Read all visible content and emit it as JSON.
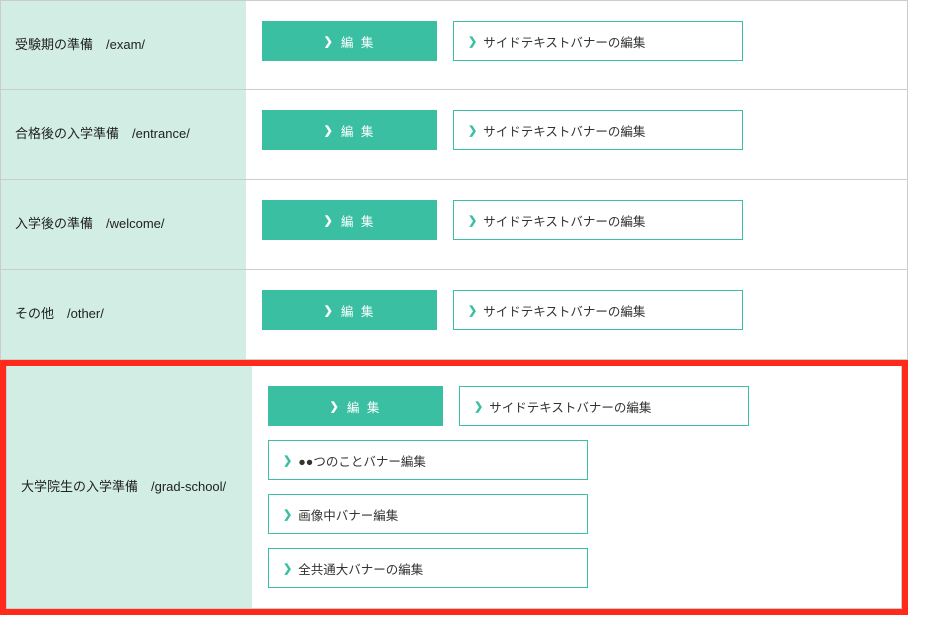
{
  "edit_label": "編 集",
  "side_banner_label": "サイドテキストバナーの編集",
  "rows": [
    {
      "label": "受験期の準備　/exam/",
      "extra": []
    },
    {
      "label": "合格後の入学準備　/entrance/",
      "extra": []
    },
    {
      "label": "入学後の準備　/welcome/",
      "extra": []
    },
    {
      "label": "その他　/other/",
      "extra": []
    },
    {
      "label": "大学院生の入学準備　/grad-school/",
      "extra": [
        "●●つのことバナー編集",
        "画像中バナー編集",
        "全共通大バナーの編集"
      ],
      "highlighted": true
    }
  ]
}
